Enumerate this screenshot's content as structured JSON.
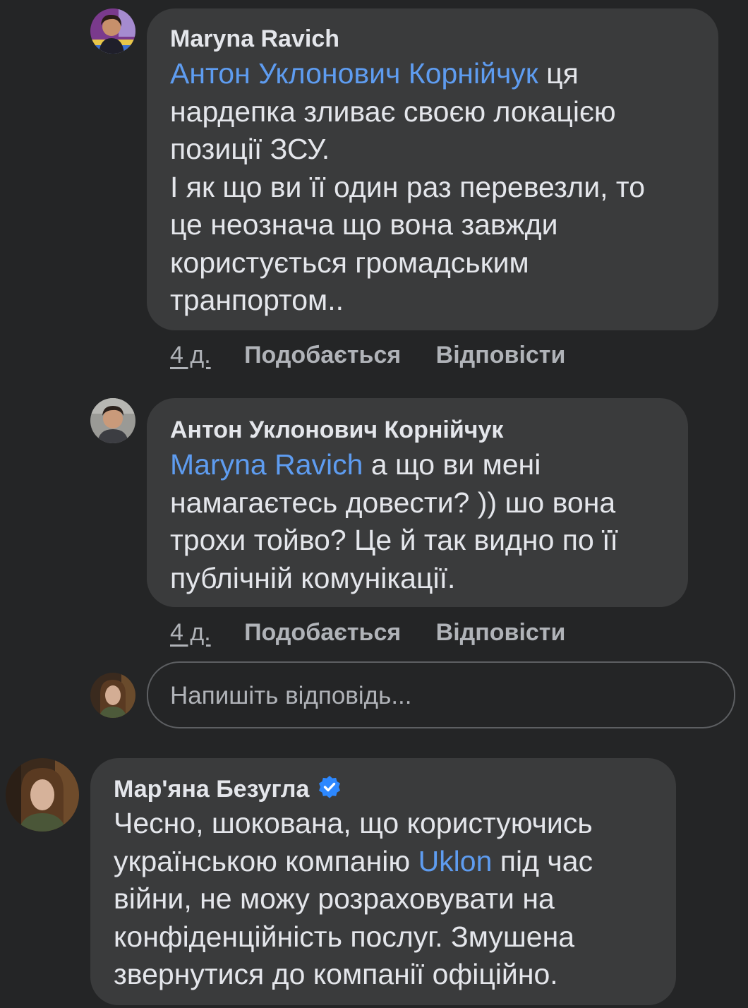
{
  "comments": [
    {
      "author": "Maryna Ravich",
      "mention": "Антон Уклонович Корнійчук",
      "lines": [
        " ця",
        "нардепка зливає своєю локацією",
        "позиції ЗСУ.",
        "І як що ви її один раз перевезли, то",
        "це неознача що вона завжди",
        "користується громадським",
        "транпортом.."
      ],
      "time": "4 д.",
      "like_label": "Подобається",
      "reply_label": "Відповісти"
    },
    {
      "author": "Антон Уклонович Корнійчук",
      "mention": "Maryna Ravich",
      "lines": [
        " а що ви мені",
        "намагаєтесь довести? )) шо вона",
        "трохи тойво? Це й так видно по її",
        "публічній комунікації."
      ],
      "time": "4 д.",
      "like_label": "Подобається",
      "reply_label": "Відповісти"
    }
  ],
  "reply_input": {
    "placeholder": "Напишіть відповідь..."
  },
  "post_comment": {
    "author": "Мар'яна Безугла",
    "verified_icon": "verified-badge-icon",
    "line1_before": "Чесно, шокована, що користуючись",
    "line2_before": "українською компанію ",
    "line2_link": "Uklon",
    "line2_after": " під час",
    "line3": "війни, не можу розраховувати на",
    "line4": "конфіденційність послуг. Змушена",
    "line5": "звернутися до компанії офіційно."
  },
  "colors": {
    "background": "#242526",
    "bubble": "#3a3b3c",
    "text": "#e4e6eb",
    "secondary_text": "#b0b3b8",
    "link": "#5e9cf0",
    "verified": "#2d88ff"
  }
}
